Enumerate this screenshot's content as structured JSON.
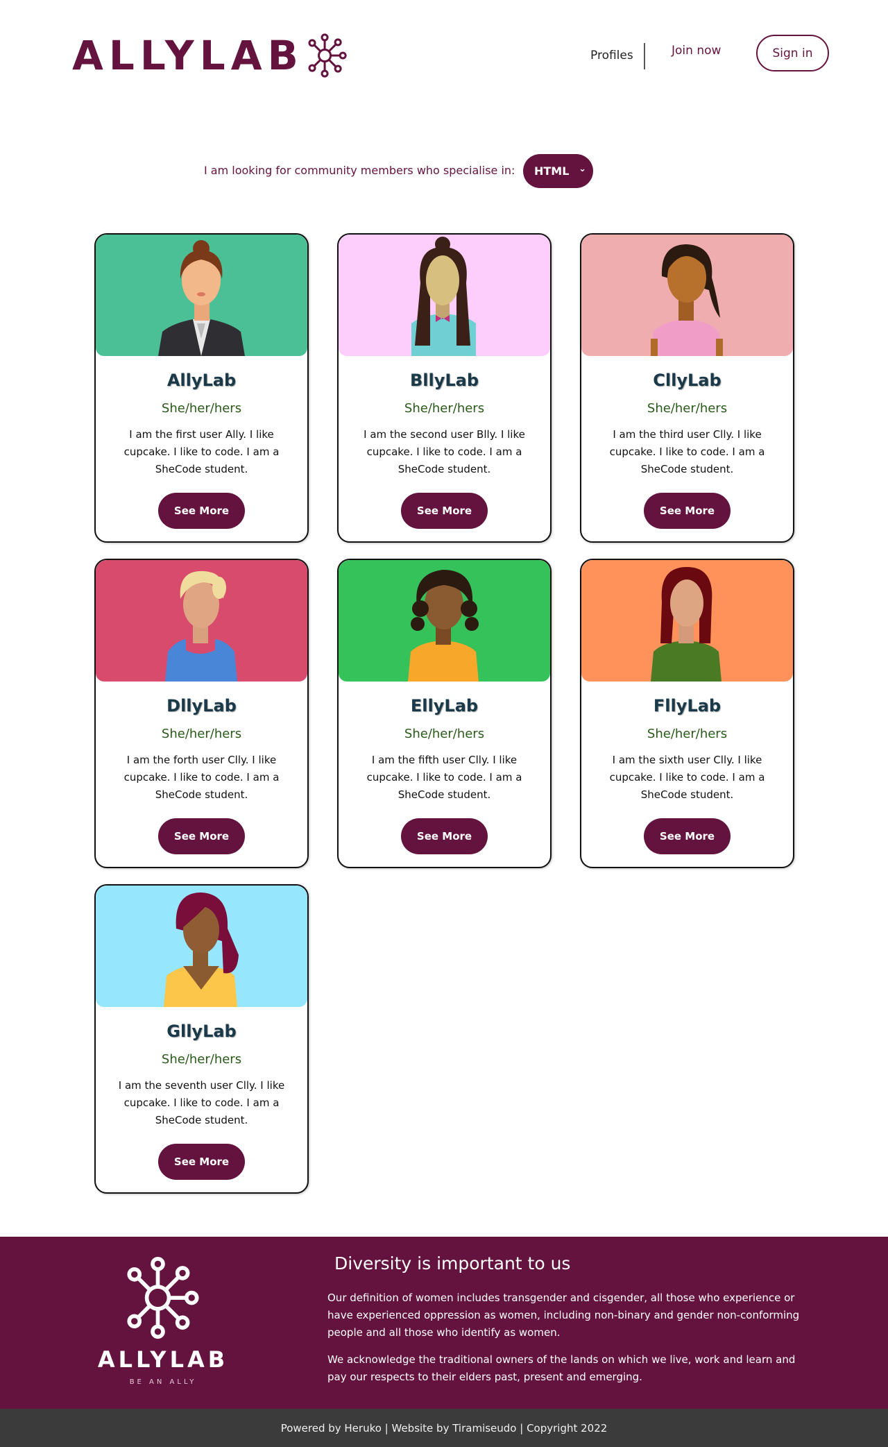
{
  "header": {
    "logo_text": "ALLYLAB",
    "nav": {
      "profiles": "Profiles",
      "join": "Join now",
      "signin": "Sign in"
    }
  },
  "filter": {
    "label": "I am looking for community members who specialise in:",
    "selected": "HTML"
  },
  "cards": [
    {
      "name": "AllyLab",
      "pronouns": "She/her/hers",
      "bio": "I am the first user Ally. I like cupcake. I like to code. I am a SheCode student.",
      "button": "See More",
      "bg": "#4bbf95"
    },
    {
      "name": "BllyLab",
      "pronouns": "She/her/hers",
      "bio": "I am the second user Blly. I like cupcake. I like to code. I am a SheCode student.",
      "button": "See More",
      "bg": "#fdcdfb"
    },
    {
      "name": "CllyLab",
      "pronouns": "She/her/hers",
      "bio": "I am the third user Clly. I like cupcake. I like to code. I am a SheCode student.",
      "button": "See More",
      "bg": "#efadb0"
    },
    {
      "name": "DllyLab",
      "pronouns": "She/her/hers",
      "bio": "I am the forth user Clly. I like cupcake. I like to code. I am a SheCode student.",
      "button": "See More",
      "bg": "#d84b6c"
    },
    {
      "name": "EllyLab",
      "pronouns": "She/her/hers",
      "bio": "I am the fifth user Clly. I like cupcake. I like to code. I am a SheCode student.",
      "button": "See More",
      "bg": "#35c25a"
    },
    {
      "name": "FllyLab",
      "pronouns": "She/her/hers",
      "bio": "I am the sixth user Clly. I like cupcake. I like to code. I am a SheCode student.",
      "button": "See More",
      "bg": "#fe925a"
    },
    {
      "name": "GllyLab",
      "pronouns": "She/her/hers",
      "bio": "I am the seventh user Clly. I like cupcake. I like to code. I am a SheCode student.",
      "button": "See More",
      "bg": "#96e6fd"
    }
  ],
  "footer": {
    "logo_text": "ALLYLAB",
    "tagline": "BE AN ALLY",
    "title": "Diversity is important to us",
    "p1": "Our definition of women includes transgender and cisgender, all those who experience or have experienced oppression as women, including non-binary and gender non-conforming people and all those who identify as women.",
    "p2": "We acknowledge the traditional owners of the lands on which we live, work and learn and pay our respects to their elders past, present and emerging.",
    "copyright": "Powered by Heruko | Website by Tiramiseudo | Copyright 2022"
  },
  "colors": {
    "brand": "#64133e",
    "bottom_bar": "#3b3b3b"
  }
}
